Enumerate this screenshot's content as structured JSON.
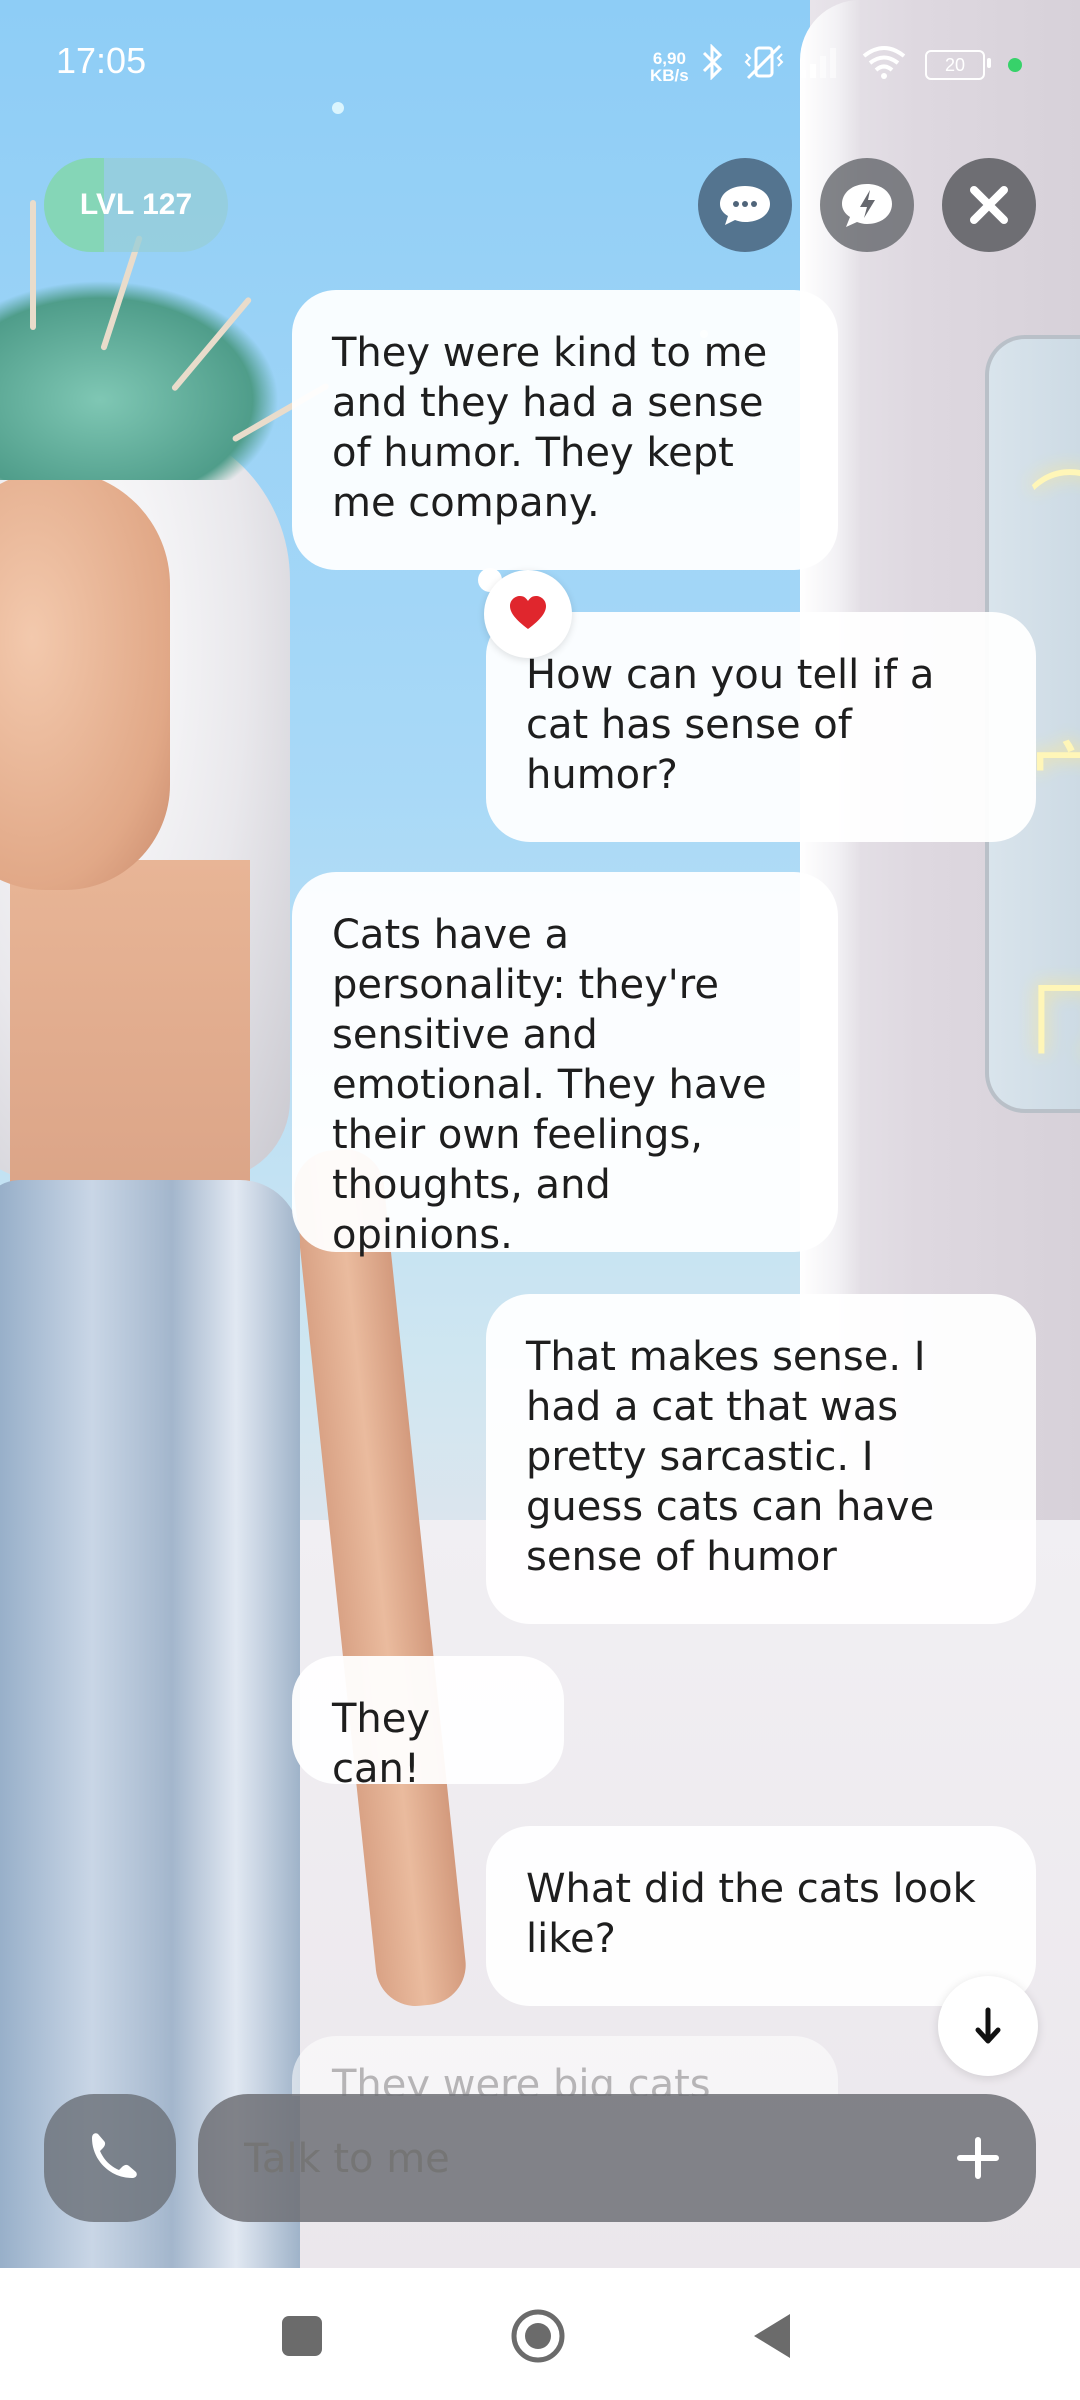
{
  "status_bar": {
    "time": "17:05",
    "net_speed_value": "6,90",
    "net_speed_unit": "KB/s",
    "battery": "20"
  },
  "top_controls": {
    "level_label": "LVL 127"
  },
  "messages": [
    {
      "from": "bot",
      "text": "They were kind to me\nand they had a sense\nof humor. They kept\nme company."
    },
    {
      "from": "user",
      "text": "How can you tell if a\ncat has sense of\nhumor?"
    },
    {
      "from": "bot",
      "text": "Cats have a\npersonality: they're\nsensitive and\nemotional. They have\ntheir own feelings,\nthoughts, and opinions."
    },
    {
      "from": "user",
      "text": "That makes sense. I\nhad a cat that was\npretty sarcastic. I\nguess cats can have\nsense of humor"
    },
    {
      "from": "bot",
      "text": "They can!"
    },
    {
      "from": "user",
      "text": "What did the cats look\nlike?"
    },
    {
      "from": "bot",
      "text": "They were big cats"
    }
  ],
  "reaction": {
    "icon": "heart-icon",
    "color": "#e0262d"
  },
  "composer": {
    "placeholder": "Talk to me"
  },
  "colors": {
    "bubble": "#ffffff",
    "controls": "#6e747d",
    "level_pill": "#96cdd7",
    "online_dot": "#37d26a"
  }
}
